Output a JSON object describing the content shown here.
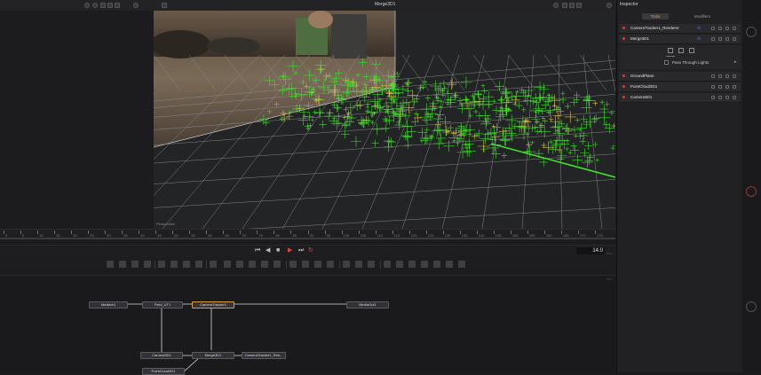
{
  "viewer": {
    "title": "Merge3D1",
    "view_label": "Perspective"
  },
  "timeline": {
    "ruler_marks": [
      "0",
      "5",
      "10",
      "15",
      "20",
      "25",
      "30",
      "35",
      "40",
      "45",
      "50",
      "55",
      "60",
      "65",
      "70",
      "75",
      "80",
      "85",
      "90",
      "95",
      "100",
      "105",
      "110",
      "115",
      "120",
      "125",
      "130",
      "135",
      "140",
      "145",
      "150",
      "155",
      "160",
      "165",
      "170",
      "175"
    ],
    "current_frame": "14.0"
  },
  "nodes": {
    "mediain": "MediaIn1",
    "fieldfilter": "Field_UT1",
    "cameratracker": "CameraTracker1",
    "mediaout": "MediaOut1",
    "camera": "Camera3D1",
    "merge": "Merge3D1",
    "renderer": "CameraTracker1_Ren...",
    "pointcloud": "PointCloud3D1"
  },
  "inspector": {
    "title": "Inspector",
    "tabs": [
      "Tools",
      "Modifiers"
    ],
    "rows": [
      {
        "label": "CameraTracker1_Renderer"
      },
      {
        "label": "Merge3D1"
      },
      {
        "label": "GroundPlane"
      },
      {
        "label": "PointCloud3D1"
      },
      {
        "label": "Camera3D1"
      }
    ],
    "pass_through_label": "Pass Through Lights"
  },
  "colors": {
    "accent": "#f0a030",
    "point_cloud": "#3fe02a",
    "selected_node": "#d59a4a",
    "node_dot": "#d24040"
  }
}
